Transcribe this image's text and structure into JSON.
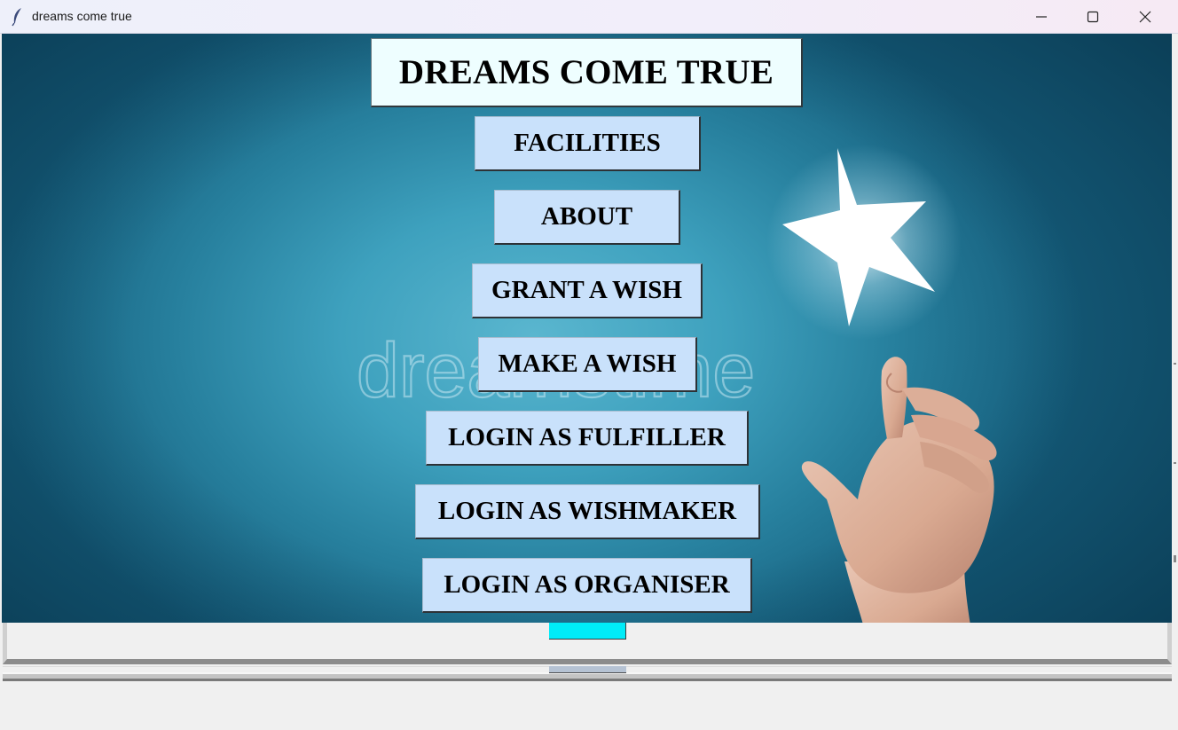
{
  "window": {
    "title": "dreams come true",
    "icon": "feather-icon",
    "controls": [
      "minimize-icon",
      "maximize-icon",
      "close-icon"
    ]
  },
  "background": {
    "watermark": "dreamstime",
    "description_icons": [
      "star-icon",
      "hand-image"
    ]
  },
  "heading": "DREAMS COME TRUE",
  "menu": {
    "facilities": "FACILITIES",
    "about": "ABOUT",
    "grant_wish": "GRANT A WISH",
    "make_wish": "MAKE A WISH",
    "login_fulfiller": "LOGIN AS FULFILLER",
    "login_wishmaker": "LOGIN AS WISHMAKER",
    "login_organiser": "LOGIN AS ORGANISER"
  },
  "colors": {
    "heading_bg": "#eefeff",
    "button_bg": "#c9e1fb",
    "accent_bar": "#00ecf8",
    "sky": "#3ea1be"
  }
}
